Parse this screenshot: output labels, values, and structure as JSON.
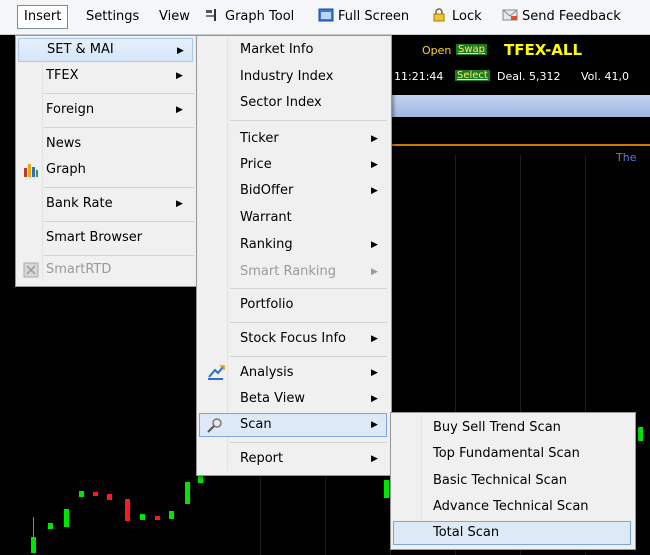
{
  "menubar": {
    "items": [
      "Insert",
      "Settings",
      "View",
      "Graph Tool",
      "Full Screen",
      "Lock",
      "Send Feedback"
    ]
  },
  "ticker": {
    "open": "Open",
    "swap": "Swap",
    "symbol": "TFEX-ALL",
    "time": "11:21:44",
    "select": "Select",
    "deal": "Deal. 5,312",
    "vol": "Vol. 41,0"
  },
  "chart": {
    "label": "The"
  },
  "insert_menu": {
    "items": [
      "SET & MAI",
      "TFEX",
      "Foreign",
      "News",
      "Graph",
      "Bank Rate",
      "Smart Browser",
      "SmartRTD"
    ]
  },
  "setmai_menu": {
    "items": [
      "Market Info",
      "Industry Index",
      "Sector Index",
      "Ticker",
      "Price",
      "BidOffer",
      "Warrant",
      "Ranking",
      "Smart Ranking",
      "Portfolio",
      "Stock Focus Info",
      "Analysis",
      "Beta View",
      "Scan",
      "Report"
    ]
  },
  "scan_menu": {
    "items": [
      "Buy Sell Trend Scan",
      "Top Fundamental Scan",
      "Basic Technical Scan",
      "Advance Technical Scan",
      "Total Scan"
    ]
  },
  "colors": {
    "ticker_symbol": "#ffff00",
    "candle_up": "#00e600",
    "candle_down": "#ff1a1a",
    "highlight": "#d5e6fa"
  }
}
